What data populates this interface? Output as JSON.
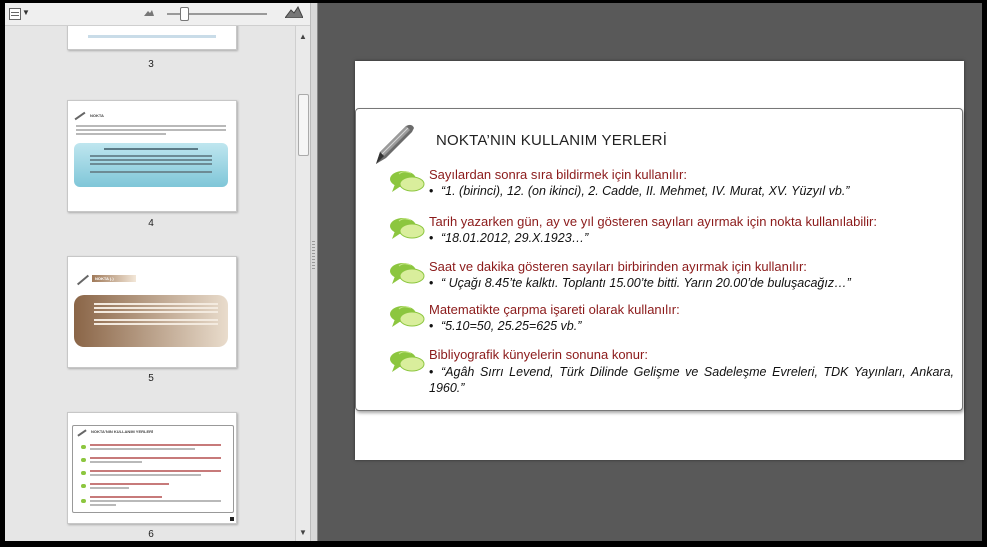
{
  "thumbnails": {
    "pages": [
      {
        "num": "3"
      },
      {
        "num": "4",
        "title": "NOKTA"
      },
      {
        "num": "5",
        "title": "NOKTA (.)"
      },
      {
        "num": "6",
        "title": "NOKTA'NIN KULLANIM YERLERİ"
      }
    ]
  },
  "slide": {
    "title": "NOKTA’NIN KULLANIM YERLERİ",
    "items": [
      {
        "heading": "Sayılardan sonra  sıra bildirmek için kullanılır:",
        "sub": "“1. (birinci), 12. (on ikinci), 2. Cadde, II. Mehmet, IV. Murat, XV. Yüzyıl vb.”"
      },
      {
        "heading": "Tarih yazarken gün, ay ve yıl gösteren sayıları ayırmak için nokta kullanılabilir:",
        "sub": "“18.01.2012, 29.X.1923…”"
      },
      {
        "heading": "Saat ve dakika gösteren sayıları birbirinden ayırmak için kullanılır:",
        "sub": "“ Uçağı 8.45’te kalktı. Toplantı 15.00’te bitti. Yarın 20.00’de buluşacağız…”"
      },
      {
        "heading": "Matematikte çarpma işareti olarak kullanılır:",
        "sub": "“5.10=50, 25.25=625 vb.”"
      },
      {
        "heading": "Bibliyografik künyelerin sonuna konur:",
        "sub": "“Agâh Sırrı Levend, Türk Dilinde Gelişme ve Sadeleşme Evreleri, TDK Yayınları, Ankara, 1960.”"
      }
    ]
  },
  "colors": {
    "heading": "#8b1a1a",
    "accent_green": "#8cc63f"
  }
}
